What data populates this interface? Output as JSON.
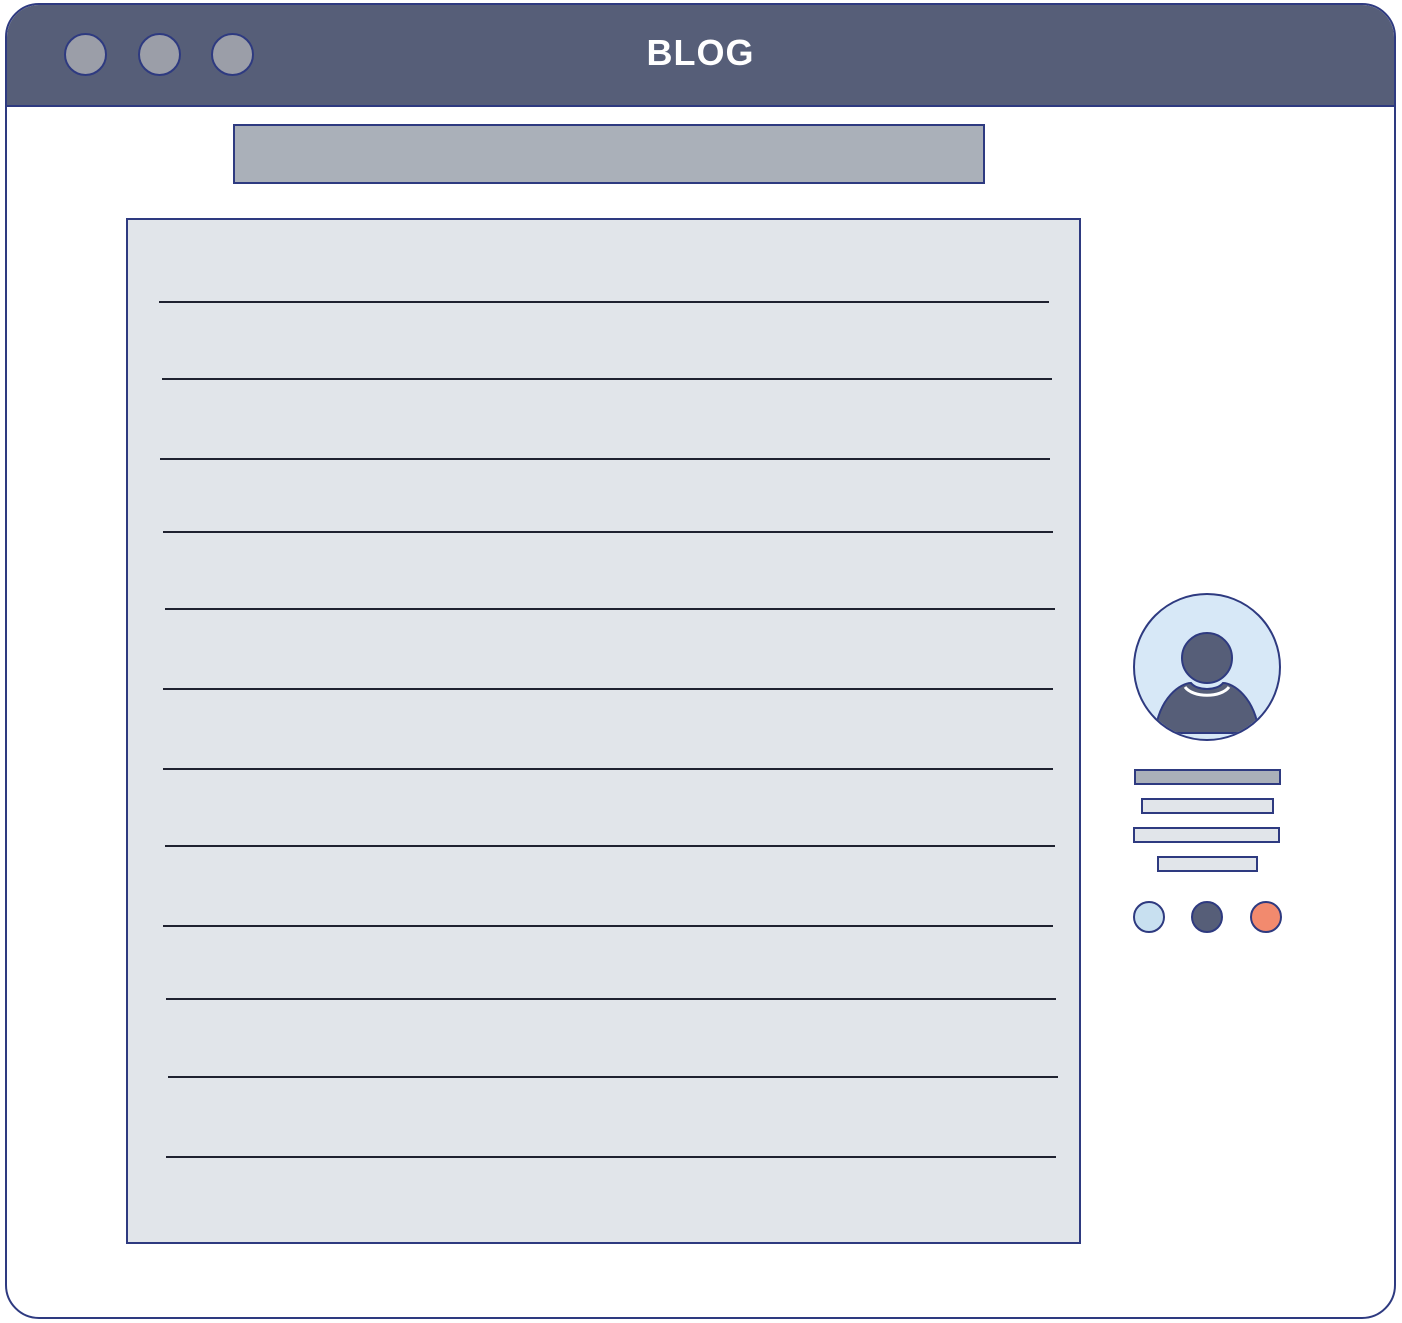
{
  "window": {
    "title": "BLOG",
    "controls": [
      "window-button-1",
      "window-button-2",
      "window-button-3"
    ]
  },
  "article": {
    "headline_placeholder": "",
    "text_line_count": 12
  },
  "sidebar": {
    "avatar_icon": "user-avatar-icon",
    "info_bars": [
      "name",
      "detail",
      "detail",
      "detail"
    ],
    "social_dots": [
      {
        "name": "social-dot-light-blue",
        "color": "#c8e0f0"
      },
      {
        "name": "social-dot-slate",
        "color": "#565e78"
      },
      {
        "name": "social-dot-coral",
        "color": "#f28a6e"
      }
    ]
  },
  "colors": {
    "titlebar": "#565e78",
    "outline": "#2e3a80",
    "content_bg": "#e1e5ea",
    "placeholder_bar": "#aab0b9"
  }
}
